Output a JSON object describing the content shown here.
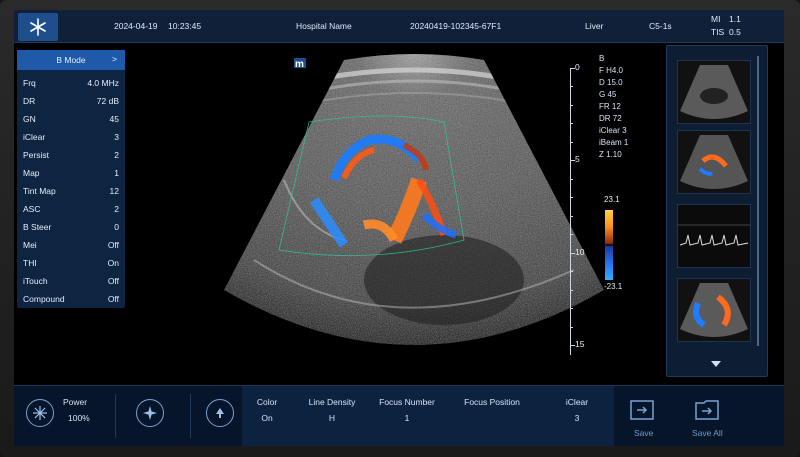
{
  "topbar": {
    "date": "2024-04-19",
    "time": "10:23:45",
    "hospital": "Hospital Name",
    "patient_id": "20240419-102345-67F1",
    "exam": "Liver",
    "probe": "C5-1s",
    "mi_label": "MI",
    "mi_value": "1.1",
    "tis_label": "TIS",
    "tis_value": "0.5"
  },
  "bmode_panel": {
    "title": "B Mode",
    "arrow": ">",
    "rows": [
      {
        "label": "Frq",
        "value": "4.0 MHz"
      },
      {
        "label": "DR",
        "value": "72 dB"
      },
      {
        "label": "GN",
        "value": "45"
      },
      {
        "label": "iClear",
        "value": "3"
      },
      {
        "label": "Persist",
        "value": "2"
      },
      {
        "label": "Map",
        "value": "1"
      },
      {
        "label": "Tint Map",
        "value": "12"
      },
      {
        "label": "ASC",
        "value": "2"
      },
      {
        "label": "B Steer",
        "value": "0"
      },
      {
        "label": "Mei",
        "value": "Off"
      },
      {
        "label": "THI",
        "value": "On"
      },
      {
        "label": "iTouch",
        "value": "Off"
      },
      {
        "label": "Compound",
        "value": "Off"
      }
    ]
  },
  "image": {
    "marker": "m",
    "depth_labels": [
      "0",
      "5",
      "10",
      "15"
    ],
    "params": [
      "B",
      "F H4.0",
      "D 15.0",
      "G 45",
      "FR 12",
      "DR 72",
      "iClear 3",
      "iBeam 1",
      "Z 1.10"
    ],
    "colorbar_max": "23.1",
    "colorbar_min": "-23.1"
  },
  "bottom": {
    "power_label": "Power",
    "power_value": "100%",
    "controls": [
      {
        "label": "Color",
        "value": "On"
      },
      {
        "label": "Line Density",
        "value": "H"
      },
      {
        "label": "Focus Number",
        "value": "1"
      },
      {
        "label": "Focus Position",
        "value": ""
      },
      {
        "label": "iClear",
        "value": "3"
      }
    ],
    "save": "Save",
    "save_all": "Save All"
  }
}
